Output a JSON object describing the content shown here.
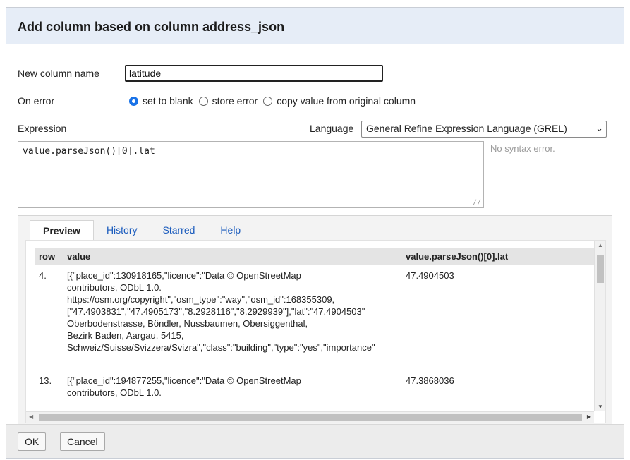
{
  "dialog": {
    "title": "Add column based on column address_json"
  },
  "form": {
    "new_column_label": "New column name",
    "new_column_value": "latitude",
    "on_error_label": "On error",
    "on_error_options": [
      {
        "label": "set to blank",
        "selected": true
      },
      {
        "label": "store error",
        "selected": false
      },
      {
        "label": "copy value from original column",
        "selected": false
      }
    ],
    "expression_label": "Expression",
    "language_label": "Language",
    "language_value": "General Refine Expression Language (GREL)",
    "expression_value": "value.parseJson()[0].lat",
    "syntax_status": "No syntax error."
  },
  "tabs": [
    {
      "label": "Preview",
      "active": true
    },
    {
      "label": "History",
      "active": false
    },
    {
      "label": "Starred",
      "active": false
    },
    {
      "label": "Help",
      "active": false
    }
  ],
  "preview": {
    "columns": [
      "row",
      "value",
      "value.parseJson()[0].lat"
    ],
    "rows": [
      {
        "row": "4.",
        "value_lines": [
          "[{\"place_id\":130918165,\"licence\":\"Data © OpenStreetMap",
          "contributors, ODbL 1.0.",
          "https://osm.org/copyright\",\"osm_type\":\"way\",\"osm_id\":168355309,",
          "[\"47.4903831\",\"47.4905173\",\"8.2928116\",\"8.2929939\"],\"lat\":\"47.4904503\"",
          "Oberbodenstrasse, Böndler, Nussbaumen, Obersiggenthal,",
          "Bezirk Baden, Aargau, 5415,",
          "Schweiz/Suisse/Svizzera/Svizra\",\"class\":\"building\",\"type\":\"yes\",\"importance\""
        ],
        "result": "47.4904503"
      },
      {
        "row": "13.",
        "value_lines": [
          "[{\"place_id\":194877255,\"licence\":\"Data © OpenStreetMap",
          "contributors, ODbL 1.0."
        ],
        "result": "47.3868036"
      }
    ]
  },
  "footer": {
    "ok_label": "OK",
    "cancel_label": "Cancel"
  }
}
